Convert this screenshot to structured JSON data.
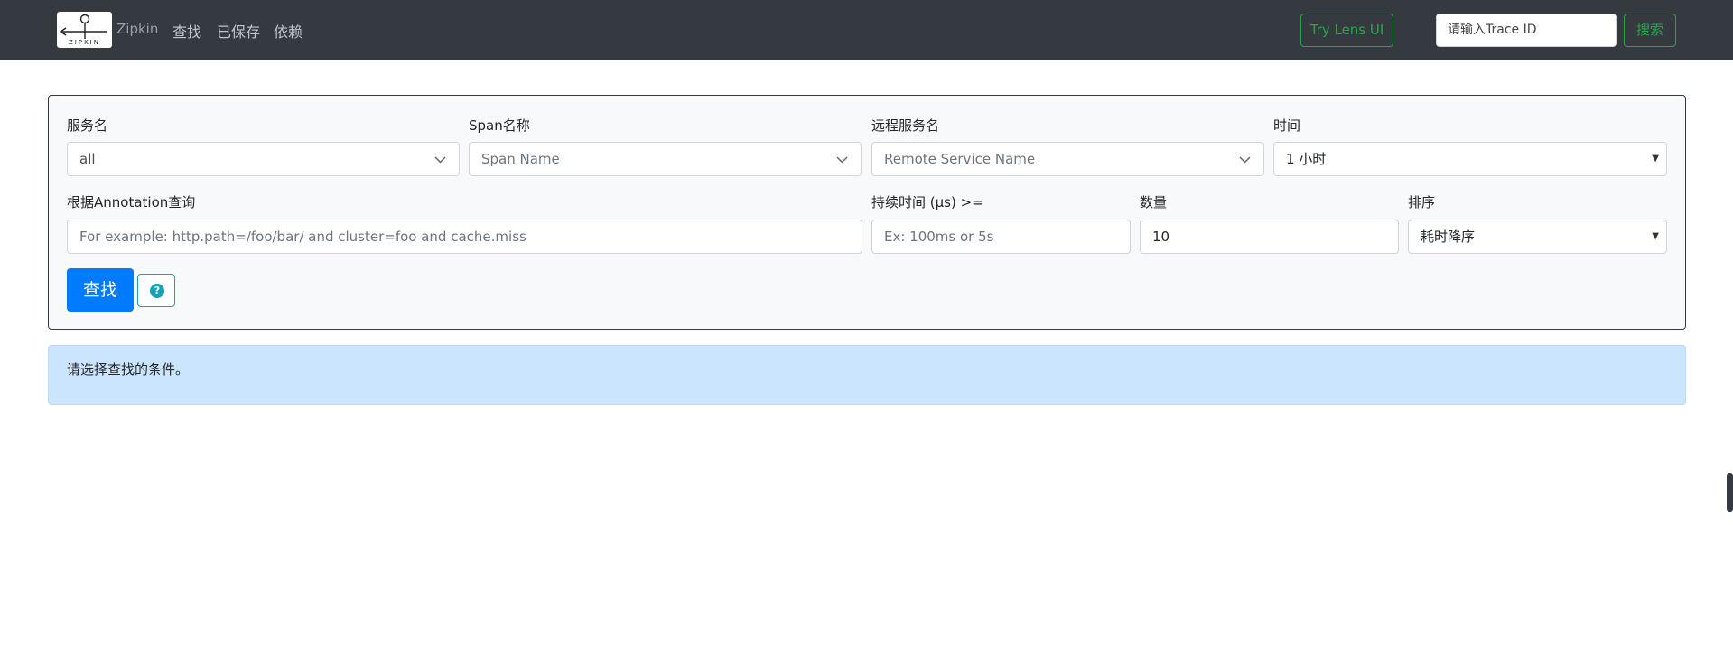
{
  "navbar": {
    "brand": "Zipkin",
    "logo_text": "ZIPKIN",
    "links": [
      "查找",
      "已保存",
      "依赖"
    ],
    "lens_button": "Try Lens UI",
    "trace_input_text": "请输入Trace ID",
    "trace_button": "搜索",
    "colors": {
      "background": "#343a40",
      "accent": "#28a745"
    }
  },
  "search": {
    "service_name": {
      "label": "服务名",
      "value": "all"
    },
    "span_name": {
      "label": "Span名称",
      "placeholder": "Span Name"
    },
    "remote_service": {
      "label": "远程服务名",
      "placeholder": "Remote Service Name"
    },
    "time": {
      "label": "时间",
      "value": "1 小时"
    },
    "annotation": {
      "label": "根据Annotation查询",
      "placeholder": "For example: http.path=/foo/bar/ and cluster=foo and cache.miss"
    },
    "duration": {
      "label": "持续时间 (μs) >=",
      "placeholder": "Ex: 100ms or 5s"
    },
    "limit": {
      "label": "数量",
      "value": "10"
    },
    "sort": {
      "label": "排序",
      "value": "耗时降序"
    },
    "search_button": "查找",
    "help_icon": "question-circle-icon"
  },
  "alert": {
    "text": "请选择查找的条件。"
  }
}
